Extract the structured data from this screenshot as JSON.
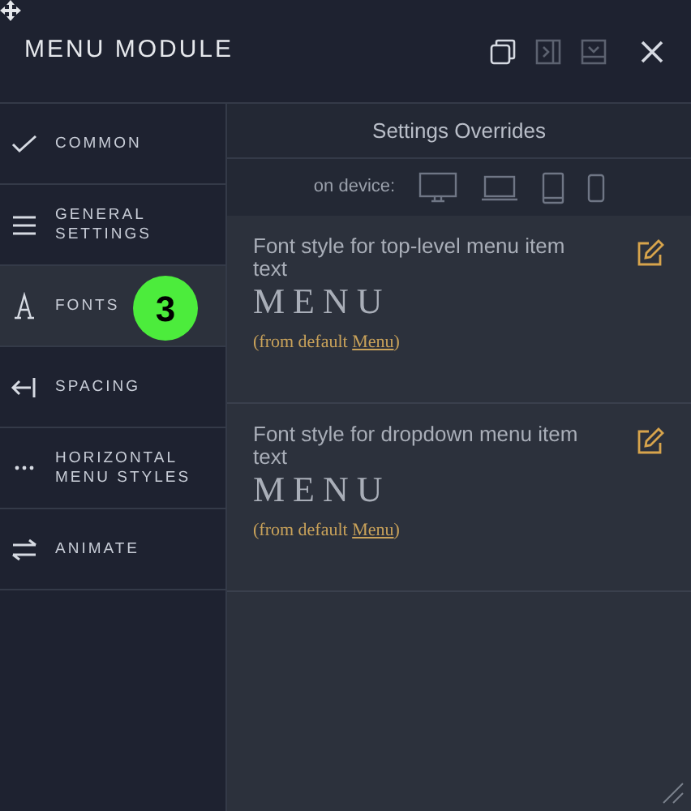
{
  "window": {
    "title": "MENU MODULE",
    "actions": [
      {
        "kind": "duplicate",
        "disabled": false
      },
      {
        "kind": "dock",
        "disabled": true
      },
      {
        "kind": "minimize",
        "disabled": true
      },
      {
        "kind": "close",
        "disabled": false
      }
    ]
  },
  "sidebar": {
    "items": [
      {
        "kind": "check",
        "label": "COMMON",
        "selected": false
      },
      {
        "kind": "lines",
        "label": "GENERAL SETTINGS",
        "selected": false
      },
      {
        "kind": "font",
        "label": "FONTS",
        "selected": true,
        "badge": "3"
      },
      {
        "kind": "arrow",
        "label": "SPACING",
        "selected": false
      },
      {
        "kind": "dots",
        "label": "HORIZONTAL MENU STYLES",
        "selected": false
      },
      {
        "kind": "swap",
        "label": "ANIMATE",
        "selected": false
      }
    ]
  },
  "overrides": {
    "title": "Settings Overrides",
    "device_label": "on device:",
    "devices": [
      {
        "kind": "desktop"
      },
      {
        "kind": "laptop"
      },
      {
        "kind": "tablet"
      },
      {
        "kind": "phone"
      }
    ]
  },
  "settings": [
    {
      "label": "Font style for top-level menu item text",
      "preview": "MENU",
      "note_prefix": "(from default ",
      "note_link": "Menu",
      "note_suffix": ")"
    },
    {
      "label": "Font style for dropdown menu item text",
      "preview": "MENU",
      "note_prefix": "(from default ",
      "note_link": "Menu",
      "note_suffix": ")"
    }
  ]
}
